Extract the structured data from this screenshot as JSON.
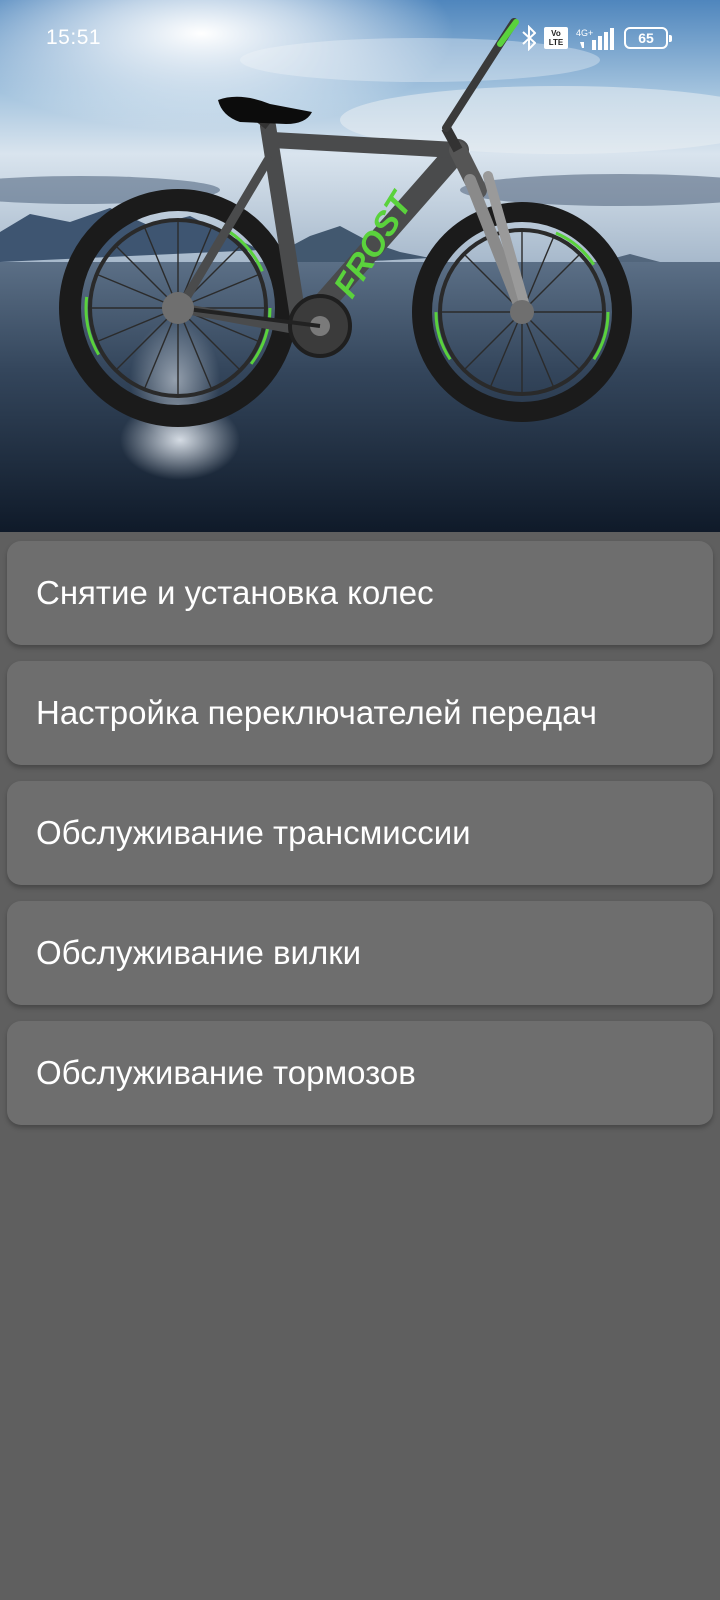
{
  "status_bar": {
    "time": "15:51",
    "volte_top": "Vo",
    "volte_bottom": "LTE",
    "network": "4G+",
    "battery": "65"
  },
  "hero": {
    "frame_text": "FROST",
    "accent_color": "#5ad23c"
  },
  "menu": {
    "items": [
      {
        "label": "Снятие и установка колес"
      },
      {
        "label": "Настройка переключателей передач"
      },
      {
        "label": "Обслуживание трансмиссии"
      },
      {
        "label": "Обслуживание вилки"
      },
      {
        "label": "Обслуживание тормозов"
      }
    ]
  }
}
